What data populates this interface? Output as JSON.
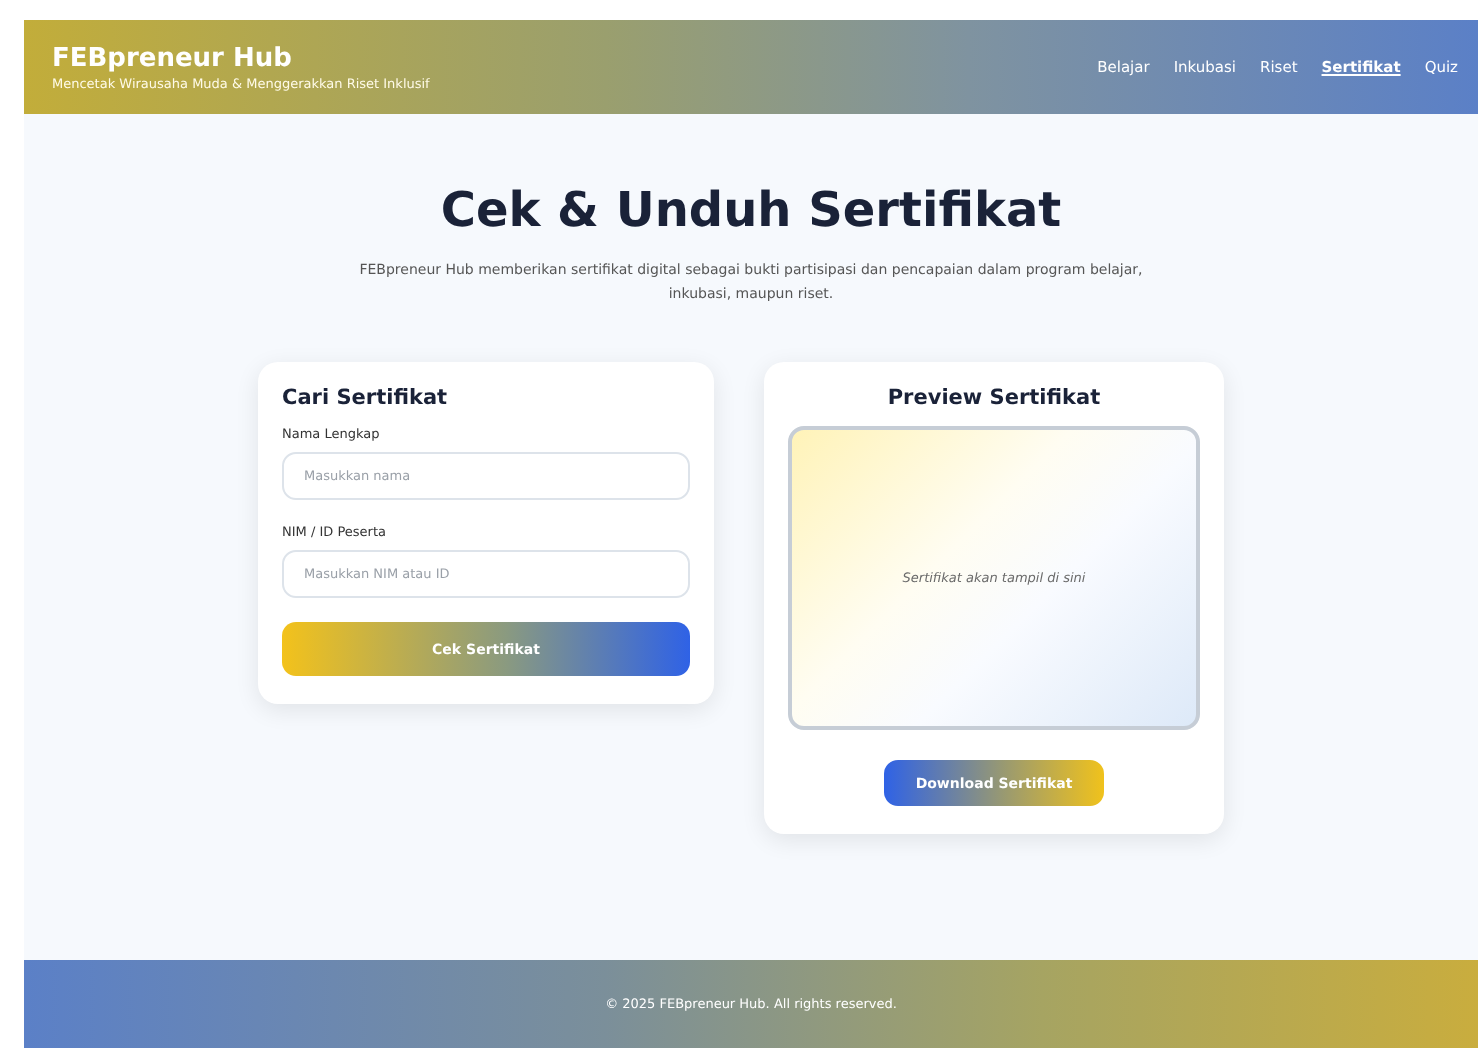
{
  "header": {
    "brand": "FEBpreneur Hub",
    "tagline": "Mencetak Wirausaha Muda & Menggerakkan Riset Inklusif",
    "nav": [
      {
        "label": "Belajar",
        "selected": false
      },
      {
        "label": "Inkubasi",
        "selected": false
      },
      {
        "label": "Riset",
        "selected": false
      },
      {
        "label": "Sertifikat",
        "selected": true
      },
      {
        "label": "Quiz",
        "selected": false
      }
    ]
  },
  "hero": {
    "title": "Cek & Unduh Sertifikat",
    "description": "FEBpreneur Hub memberikan sertifikat digital sebagai bukti partisipasi dan pencapaian dalam program belajar, inkubasi, maupun riset."
  },
  "search_card": {
    "title": "Cari Sertifikat",
    "fields": [
      {
        "label": "Nama Lengkap",
        "placeholder": "Masukkan nama"
      },
      {
        "label": "NIM / ID Peserta",
        "placeholder": "Masukkan NIM atau ID"
      }
    ],
    "button": "Cek Sertifikat"
  },
  "preview_card": {
    "title": "Preview Sertifikat",
    "placeholder_text": "Sertifikat akan tampil di sini",
    "button": "Download Sertifikat"
  },
  "footer": {
    "text": "© 2025 FEBpreneur Hub. All rights reserved."
  }
}
